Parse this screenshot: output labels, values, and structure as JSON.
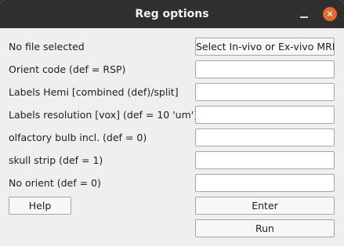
{
  "window": {
    "title": "Reg options",
    "minimize_icon": "minimize-icon",
    "close_icon": "close-icon",
    "close_glyph": "✕",
    "accent": "#e8672a"
  },
  "form": {
    "file_label": "No file selected",
    "select_button": "Select In-vivo or Ex-vivo MRI",
    "rows": [
      {
        "label": "Orient code (def = RSP)",
        "value": ""
      },
      {
        "label": "Labels Hemi [combined (def)/split]",
        "value": ""
      },
      {
        "label": "Labels resolution [vox] (def = 10 'um')",
        "value": ""
      },
      {
        "label": "olfactory bulb incl. (def = 0)",
        "value": ""
      },
      {
        "label": "skull strip (def = 1)",
        "value": ""
      },
      {
        "label": "No orient (def = 0)",
        "value": ""
      }
    ]
  },
  "buttons": {
    "help": "Help",
    "enter": "Enter",
    "run": "Run"
  }
}
